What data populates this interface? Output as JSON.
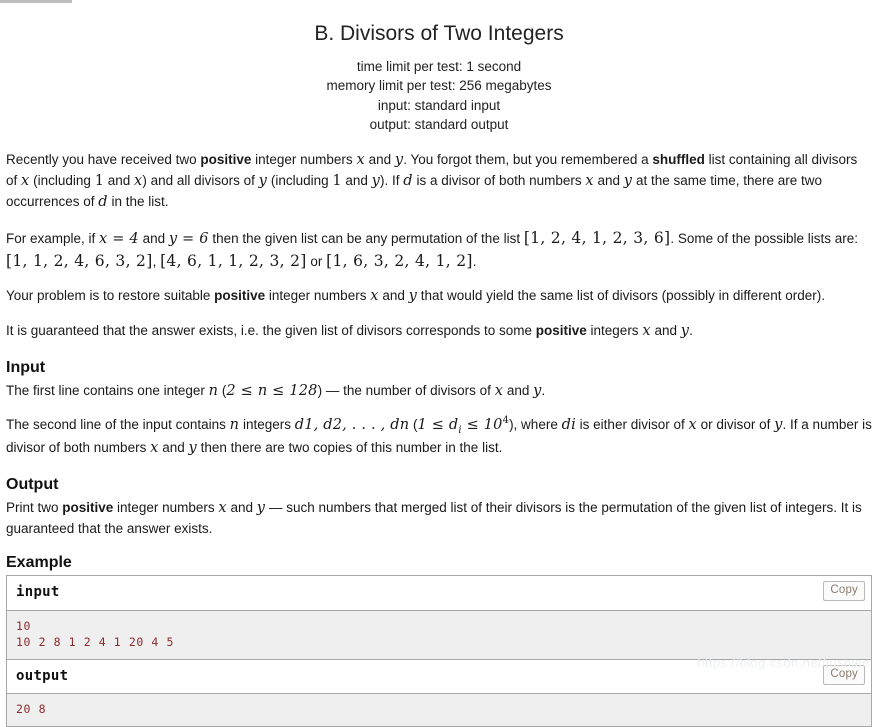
{
  "problem": {
    "title": "B. Divisors of Two Integers",
    "limits": [
      "time limit per test: 1 second",
      "memory limit per test: 256 megabytes",
      "input: standard input",
      "output: standard output"
    ]
  },
  "statement": {
    "p1": {
      "a": "Recently you have received two ",
      "b_positive": "positive",
      "c": " integer numbers ",
      "m_x": "x",
      "d": " and ",
      "m_y": "y",
      "e": ". You forgot them, but you remembered a ",
      "b_shuffled": "shuffled",
      "f": " list containing all divisors of ",
      "m_x2": "x",
      "g": " (including ",
      "m_1a": "1",
      "h": " and ",
      "m_x3": "x",
      "i": ") and all divisors of ",
      "m_y2": "y",
      "j": " (including ",
      "m_1b": "1",
      "k": " and ",
      "m_y3": "y",
      "l": "). If ",
      "m_d": "d",
      "m": " is a divisor of both numbers ",
      "m_x4": "x",
      "n": " and ",
      "m_y4": "y",
      "o": " at the same time, there are two occurrences of ",
      "m_d2": "d",
      "p": " in the list."
    },
    "p2": {
      "a": "For example, if ",
      "eq_x": "x = 4",
      "b": " and ",
      "eq_y": "y = 6",
      "c": " then the given list can be any permutation of the list ",
      "list_main": "[1, 2, 4, 1, 2, 3, 6]",
      "d": ". Some of the possible lists are: ",
      "list_1": "[1, 1, 2, 4, 6, 3, 2]",
      "e": ", ",
      "list_2": "[4, 6, 1, 1, 2, 3, 2]",
      "f": " or ",
      "list_3": "[1, 6, 3, 2, 4, 1, 2]",
      "g": "."
    },
    "p3": {
      "a": "Your problem is to restore suitable ",
      "b_positive": "positive",
      "b": " integer numbers ",
      "m_x": "x",
      "c": " and ",
      "m_y": "y",
      "d": " that would yield the same list of divisors (possibly in different order)."
    },
    "p4": {
      "a": "It is guaranteed that the answer exists, i.e. the given list of divisors corresponds to some ",
      "b_positive": "positive",
      "b": " integers ",
      "m_x": "x",
      "c": " and ",
      "m_y": "y",
      "d": "."
    }
  },
  "input_section": {
    "heading": "Input",
    "p1": {
      "a": "The first line contains one integer ",
      "m_n": "n",
      "b": " (",
      "range": "2 ≤ n ≤ 128",
      "c": ") — the number of divisors of ",
      "m_x": "x",
      "d": " and ",
      "m_y": "y",
      "e": "."
    },
    "p2": {
      "a": "The second line of the input contains ",
      "m_n": "n",
      "b": " integers ",
      "seq": "d1, d2, . . . , dn",
      "c": " (",
      "range_pre": "1 ≤ d",
      "range_sub": "i",
      "range_mid": " ≤ 10",
      "range_sup": "4",
      "d": "), where ",
      "m_di": "di",
      "e": " is either divisor of ",
      "m_x": "x",
      "f": " or divisor of ",
      "m_y": "y",
      "g": ". If a number is divisor of both numbers ",
      "m_x2": "x",
      "h": " and ",
      "m_y2": "y",
      "i": " then there are two copies of this number in the list."
    }
  },
  "output_section": {
    "heading": "Output",
    "p1": {
      "a": "Print two ",
      "b_positive": "positive",
      "b": " integer numbers ",
      "m_x": "x",
      "c": " and ",
      "m_y": "y",
      "d": " — such numbers that merged list of their divisors is the permutation of the given list of integers. It is guaranteed that the answer exists."
    }
  },
  "example_section": {
    "heading": "Example",
    "copy_label": "Copy",
    "blocks": [
      {
        "title": "input",
        "content": "10\n10 2 8 1 2 4 1 20 4 5"
      },
      {
        "title": "output",
        "content": "20 8"
      }
    ]
  },
  "watermark": "https://blog.csdn.net/jusoiee"
}
